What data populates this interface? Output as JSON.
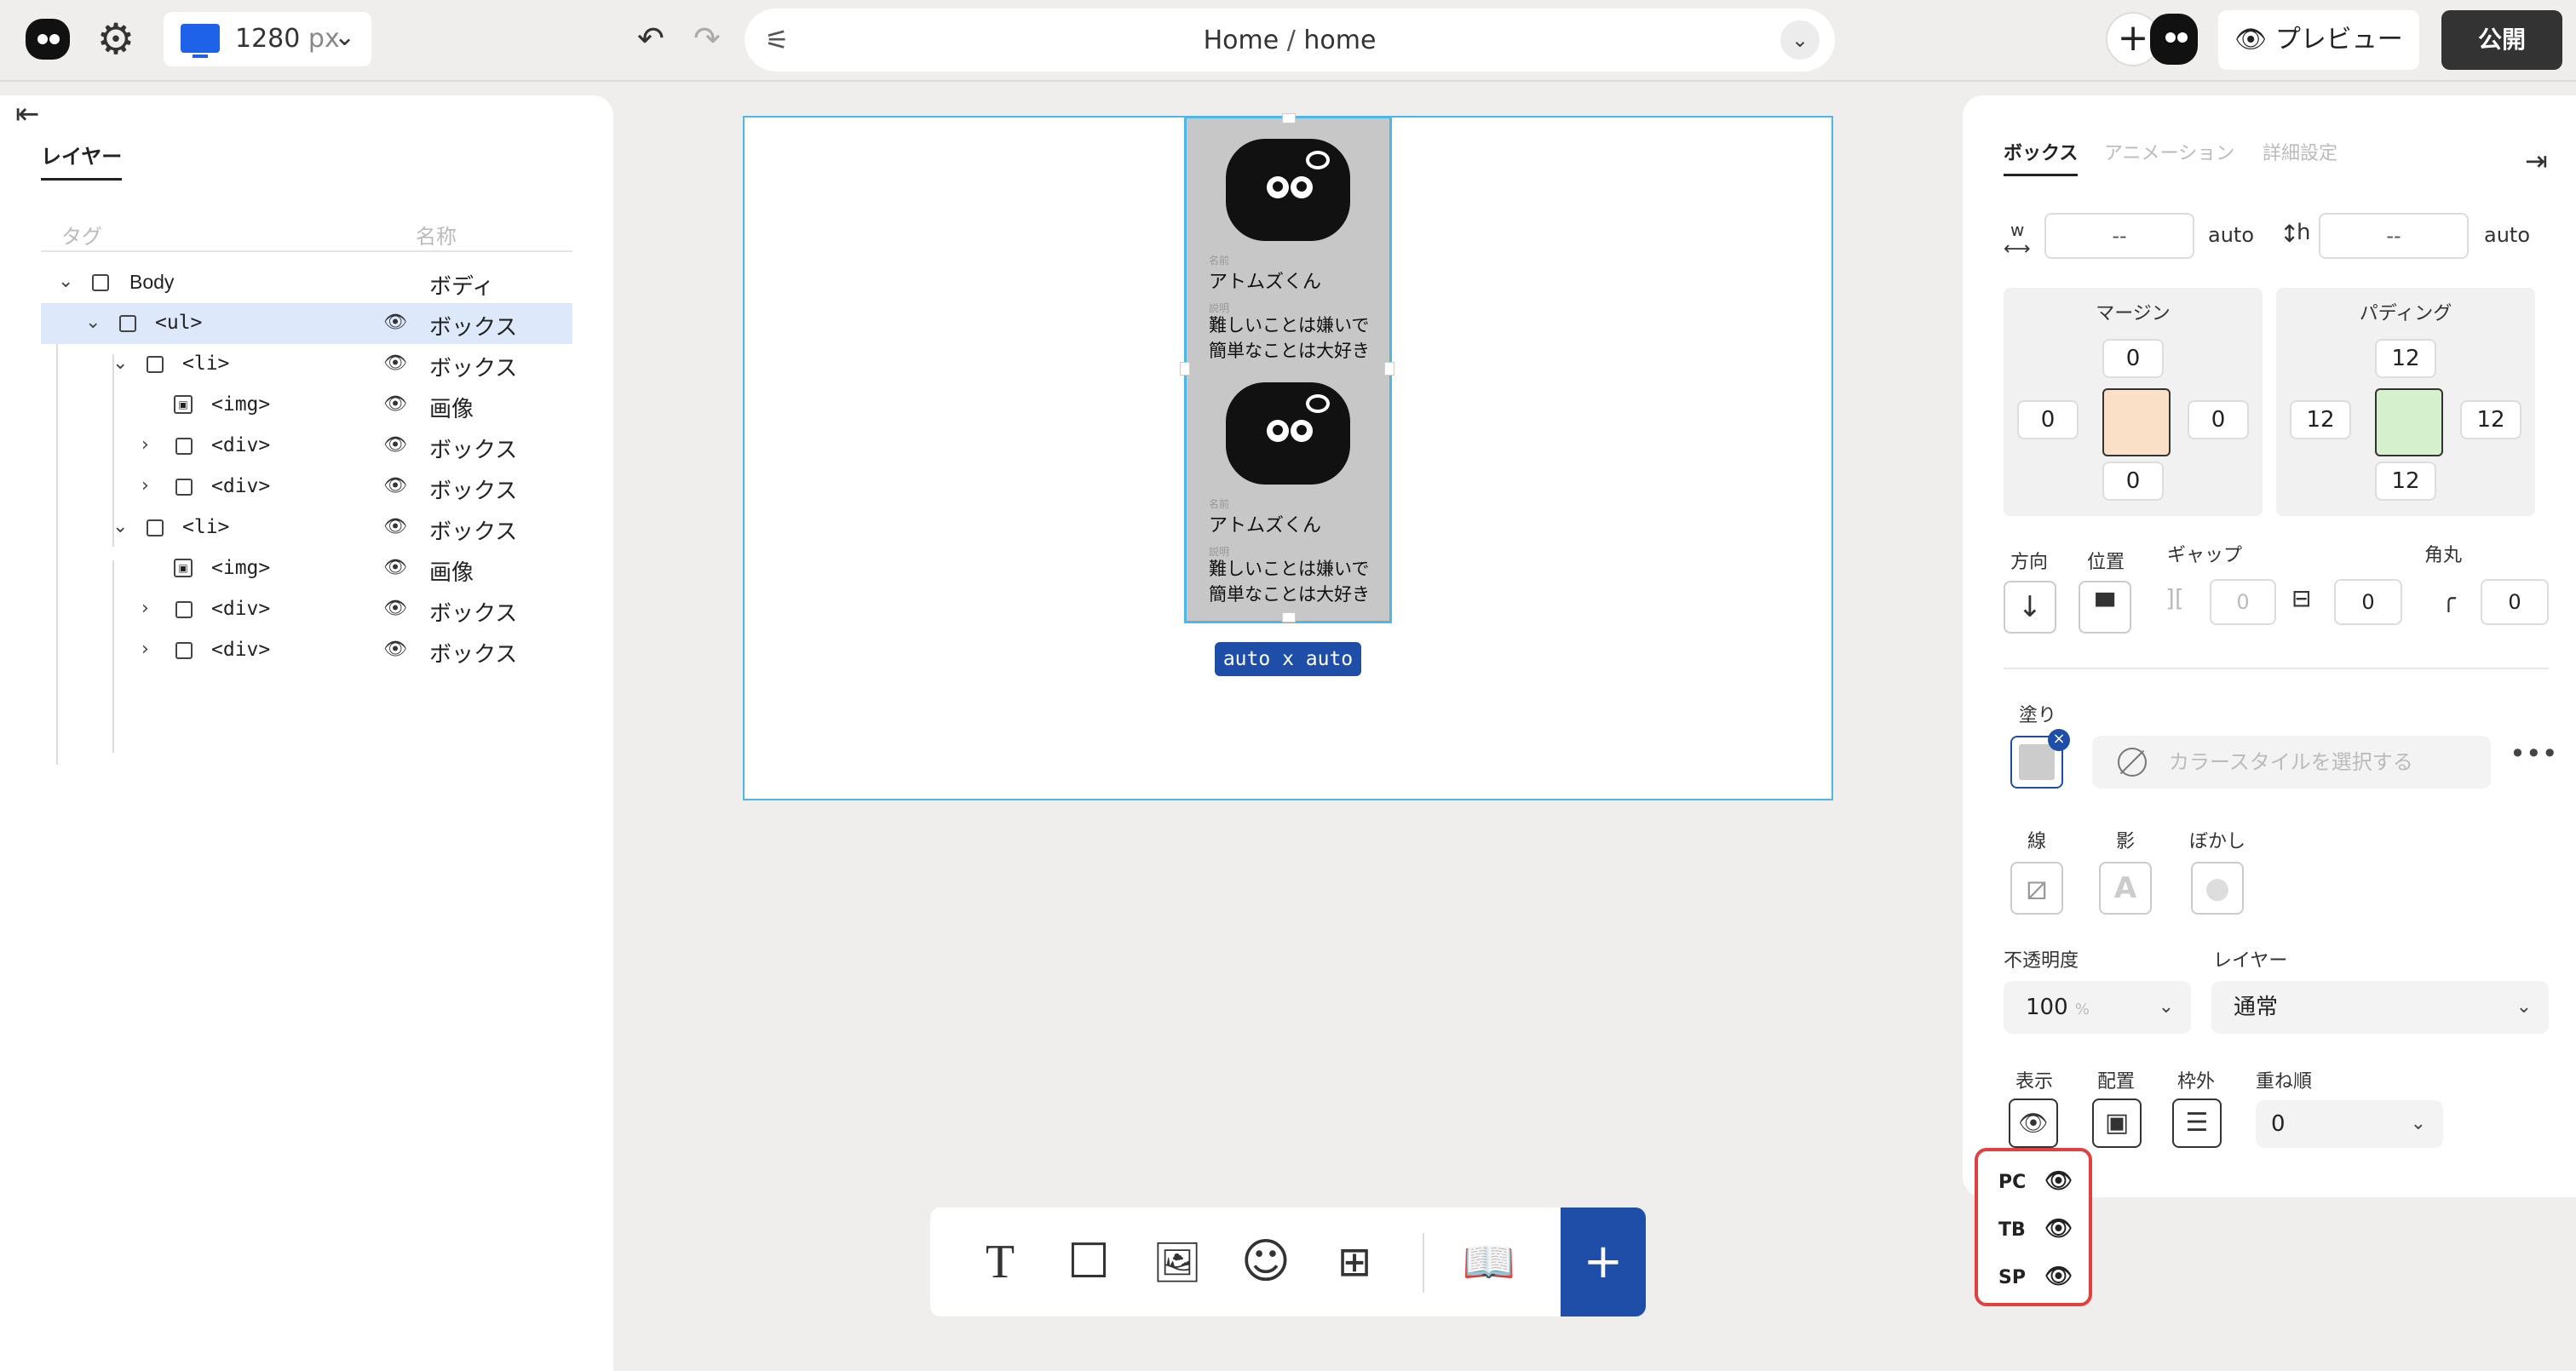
{
  "topbar": {
    "device_width": "1280",
    "device_unit": "px",
    "path_page": "Home",
    "path_sep": "/",
    "path_slug": "home",
    "preview_label": "プレビュー",
    "publish_label": "公開"
  },
  "layers": {
    "tab_label": "レイヤー",
    "col_tag": "タグ",
    "col_name": "名称",
    "rows": [
      {
        "tag": "Body",
        "name": "ボディ"
      },
      {
        "tag": "<ul>",
        "name": "ボックス"
      },
      {
        "tag": "<li>",
        "name": "ボックス"
      },
      {
        "tag": "<img>",
        "name": "画像"
      },
      {
        "tag": "<div>",
        "name": "ボックス"
      },
      {
        "tag": "<div>",
        "name": "ボックス"
      },
      {
        "tag": "<li>",
        "name": "ボックス"
      },
      {
        "tag": "<img>",
        "name": "画像"
      },
      {
        "tag": "<div>",
        "name": "ボックス"
      },
      {
        "tag": "<div>",
        "name": "ボックス"
      }
    ]
  },
  "canvas": {
    "cards": [
      {
        "name_caption": "名前",
        "name": "アトムズくん",
        "desc_caption": "説明",
        "desc": "難しいことは嫌いで簡単なことは大好き"
      },
      {
        "name_caption": "名前",
        "name": "アトムズくん",
        "desc_caption": "説明",
        "desc": "難しいことは嫌いで簡単なことは大好き"
      }
    ],
    "size_badge": "auto x auto"
  },
  "props": {
    "tabs": [
      "ボックス",
      "アニメーション",
      "詳細設定"
    ],
    "w_label": "w",
    "h_label": "h",
    "w_value": "--",
    "h_value": "--",
    "w_auto": "auto",
    "h_auto": "auto",
    "margin": {
      "title": "マージン",
      "top": "0",
      "right": "0",
      "bottom": "0",
      "left": "0"
    },
    "padding": {
      "title": "パディング",
      "top": "12",
      "right": "12",
      "bottom": "12",
      "left": "12"
    },
    "direction_label": "方向",
    "position_label": "位置",
    "gap_label": "ギャップ",
    "gap_value1": "0",
    "gap_value2": "0",
    "radius_label": "角丸",
    "radius_value": "0",
    "fill_label": "塗り",
    "color_style_placeholder": "カラースタイルを選択する",
    "stroke_label": "線",
    "shadow_label": "影",
    "blur_label": "ぼかし",
    "opacity_label": "不透明度",
    "opacity_value": "100",
    "opacity_unit": "%",
    "layer_label": "レイヤー",
    "layer_value": "通常",
    "display_label": "表示",
    "placement_label": "配置",
    "outside_label": "枠外",
    "zorder_label": "重ね順",
    "zorder_value": "0",
    "visibility": [
      "PC",
      "TB",
      "SP"
    ]
  },
  "colors": {
    "accent": "#1e4ea8",
    "selection": "#4db7e6",
    "margin_center": "#fbe0c8",
    "padding_center": "#d4f0cc",
    "highlight": "#e24040"
  }
}
